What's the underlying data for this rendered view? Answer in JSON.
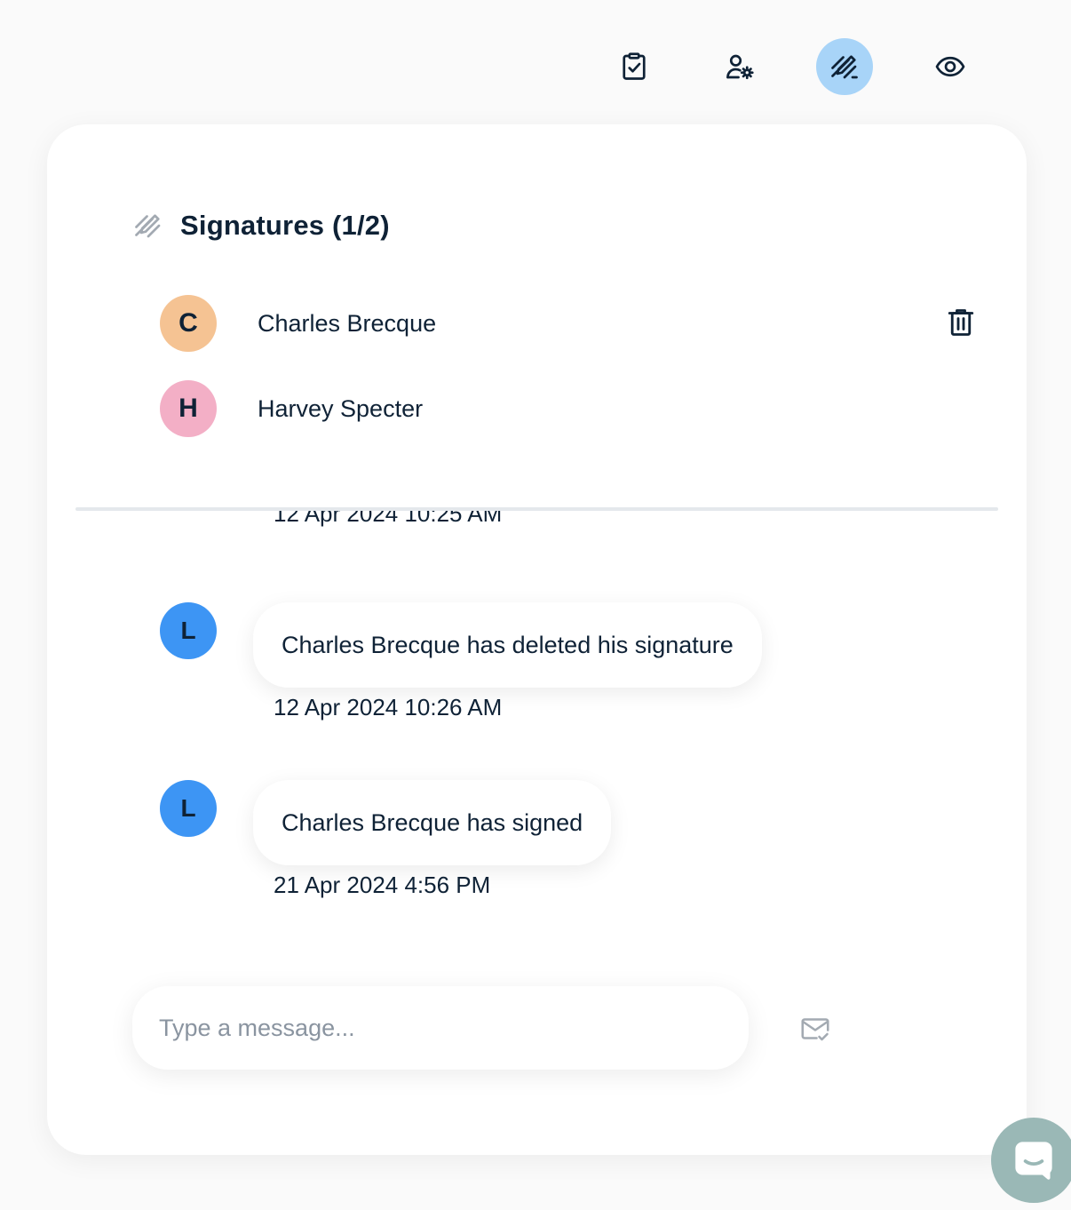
{
  "toolbar": {
    "buttons": [
      {
        "icon": "clipboard-check-icon",
        "active": false
      },
      {
        "icon": "user-gear-icon",
        "active": false
      },
      {
        "icon": "signature-pen-icon",
        "active": true
      },
      {
        "icon": "eye-icon",
        "active": false
      }
    ],
    "active_color": "#a8d4f8"
  },
  "signatures": {
    "title": "Signatures (1/2)",
    "icon": "signature-pen-icon",
    "signers": [
      {
        "initial": "C",
        "name": "Charles Brecque",
        "color": "#f5c393",
        "deletable": true
      },
      {
        "initial": "H",
        "name": "Harvey Specter",
        "color": "#f3afc6",
        "deletable": false
      }
    ]
  },
  "activity": {
    "clipped_timestamp": "12 Apr 2024 10:25 AM",
    "messages": [
      {
        "initial": "L",
        "text": "Charles Brecque has deleted his signature",
        "timestamp": "12 Apr 2024 10:26 AM"
      },
      {
        "initial": "L",
        "text": "Charles Brecque has signed",
        "timestamp": "21 Apr 2024 4:56 PM"
      }
    ],
    "avatar_color": "#3d95f4"
  },
  "composer": {
    "placeholder": "Type a message...",
    "send_icon": "mail-check-icon"
  },
  "chat_launcher": {
    "icon": "chat-bubble-icon",
    "color": "#9ab8b6"
  }
}
